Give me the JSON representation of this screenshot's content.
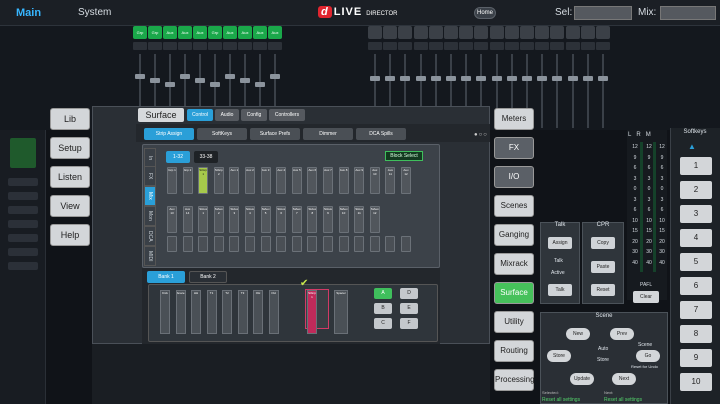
{
  "app": {
    "tab_main": "Main",
    "tab_system": "System",
    "logo_mark": "d",
    "logo_text": "LIVE",
    "logo_sub": "DIRECTOR",
    "home": "Home",
    "sel_label": "Sel:",
    "mix_label": "Mix:"
  },
  "channels": {
    "green_labels": [
      "Grp",
      "Grp",
      "Aux",
      "Aux",
      "Aux",
      "Grp",
      "Aux",
      "Aux",
      "Aux",
      "Aux"
    ],
    "accent": "#1aa84a"
  },
  "left_nav": [
    "Lib",
    "Setup",
    "Listen",
    "View",
    "Help"
  ],
  "surface": {
    "title": "Surface",
    "top_tabs": [
      "Control",
      "Audio",
      "Config",
      "Controllers"
    ],
    "sub_tabs": [
      "Strip Assign",
      "SoftKeys",
      "Surface Prefs",
      "Dimmer",
      "DCA Spills"
    ],
    "layer_tabs": [
      "In",
      "FX",
      "Mix",
      "Mon",
      "DCA",
      "MIDI"
    ],
    "range_1": "1-32",
    "range_2": "33-38",
    "block_select": "Block Select",
    "row1": [
      "Grp 1",
      "Grp 2",
      "StGrp 1",
      "StGrp 2",
      "Aux 1",
      "Aux 2",
      "Aux 3",
      "Aux 4",
      "Aux 5",
      "Aux 6",
      "Aux 7",
      "Aux 8",
      "Aux 9",
      "Aux 10",
      "Aux 11",
      "Aux 12"
    ],
    "row2": [
      "Aux 13",
      "Aux 14",
      "StAux 1",
      "StAux 2",
      "StAux 3",
      "StAux 4",
      "StAux 5",
      "StAux 6",
      "StAux 7",
      "StAux 8",
      "StAux 9",
      "StAux 10",
      "StAux 11",
      "StAux 12"
    ],
    "bank_1": "Bank 1",
    "bank_2": "Bank 2",
    "bank_slots": [
      "Kick",
      "Snare",
      "HH",
      "T1",
      "T2",
      "T3",
      "OH",
      "OH",
      "StGrp 1",
      "Spacer"
    ],
    "abc": [
      "A",
      "D",
      "B",
      "E",
      "C",
      "F"
    ]
  },
  "right_nav": [
    "Meters",
    "FX",
    "I/O",
    "Scenes",
    "Ganging",
    "Mixrack",
    "Surface",
    "Utility",
    "Routing",
    "Processing"
  ],
  "meters": {
    "head": [
      "L",
      "R",
      "M"
    ],
    "scale": [
      "12",
      "9",
      "6",
      "3",
      "0",
      "3",
      "6",
      "10",
      "15",
      "20",
      "30",
      "40"
    ],
    "pafl": "PAFL",
    "clear": "Clear"
  },
  "talk": {
    "title": "Talk",
    "assign": "Assign",
    "talk_active": "Talk",
    "active": "Active",
    "talk_btn": "Talk"
  },
  "cpr": {
    "title": "CPR",
    "copy": "Copy",
    "paste": "Paste",
    "reset": "Reset"
  },
  "scene": {
    "title": "Scene",
    "new": "New",
    "prev": "Prev",
    "auto": "Auto",
    "store_btn": "Store",
    "store_label": "Store",
    "scene_label": "Scene",
    "goto": "Go",
    "reset_for_undo": "Reset for Undo",
    "update": "Update",
    "next": "Next",
    "selected_label": "Selected:",
    "selected_value": "Reset all settings",
    "next_label": "Next:",
    "next_value": "Reset all settings"
  },
  "softkeys": {
    "title": "Softkeys",
    "keys": [
      "1",
      "2",
      "3",
      "4",
      "5",
      "6",
      "7",
      "8",
      "9",
      "10"
    ]
  }
}
